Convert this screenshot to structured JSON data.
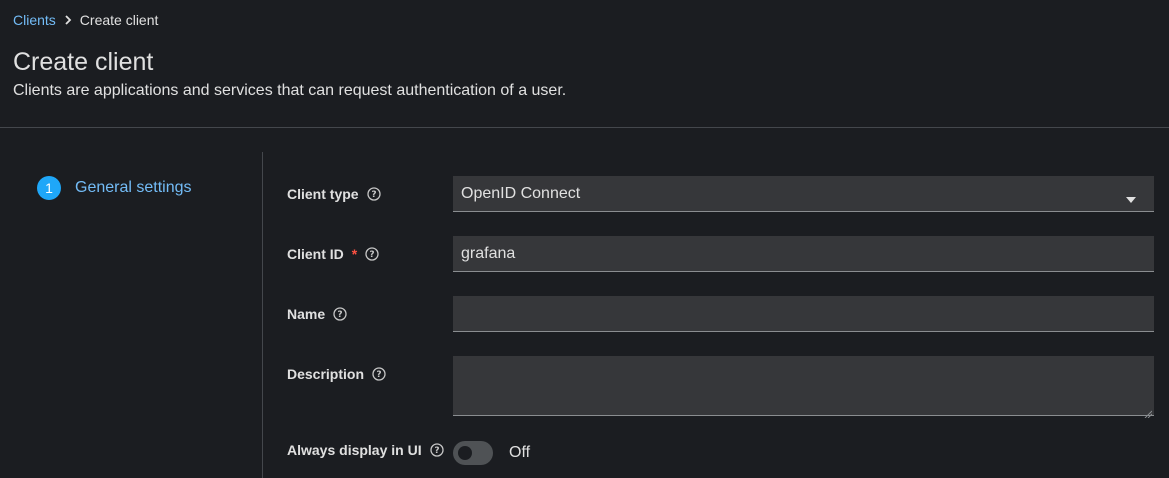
{
  "breadcrumb": {
    "parent": "Clients",
    "current": "Create client"
  },
  "header": {
    "title": "Create client",
    "description": "Clients are applications and services that can request authentication of a user."
  },
  "wizard": {
    "steps": [
      {
        "number": "1",
        "label": "General settings",
        "active": true
      }
    ]
  },
  "form": {
    "client_type": {
      "label": "Client type",
      "value": "OpenID Connect"
    },
    "client_id": {
      "label": "Client ID",
      "required_mark": "*",
      "value": "grafana"
    },
    "name": {
      "label": "Name",
      "value": ""
    },
    "description": {
      "label": "Description",
      "value": ""
    },
    "always_display": {
      "label": "Always display in UI",
      "state_text": "Off",
      "enabled": false
    }
  },
  "colors": {
    "background": "#1b1d21",
    "link": "#73bcf7",
    "step_active": "#1fa7f8",
    "input_bg": "#36373a",
    "required": "#fe5142"
  },
  "icons": {
    "breadcrumb_separator": "chevron-right-icon",
    "help": "question-circle-icon",
    "select_caret": "caret-down-icon"
  }
}
